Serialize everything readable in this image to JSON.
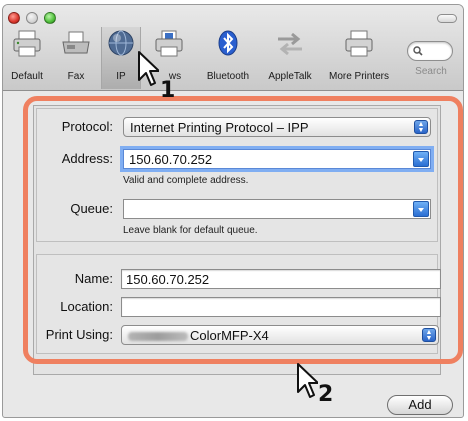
{
  "toolbar": {
    "items": [
      {
        "label": "Default",
        "icon": "default-printer-icon"
      },
      {
        "label": "Fax",
        "icon": "fax-icon"
      },
      {
        "label": "IP",
        "icon": "ip-globe-icon",
        "selected": true
      },
      {
        "label": "ws",
        "icon": "windows-printer-icon"
      },
      {
        "label": "Bluetooth",
        "icon": "bluetooth-icon"
      },
      {
        "label": "AppleTalk",
        "icon": "appletalk-icon"
      },
      {
        "label": "More Printers",
        "icon": "more-printers-icon"
      }
    ],
    "search_label": "Search"
  },
  "form": {
    "protocol": {
      "label": "Protocol:",
      "value": "Internet Printing Protocol – IPP"
    },
    "address": {
      "label": "Address:",
      "value": "150.60.70.252",
      "hint": "Valid and complete address."
    },
    "queue": {
      "label": "Queue:",
      "value": "",
      "hint": "Leave blank for default queue."
    },
    "name": {
      "label": "Name:",
      "value": "150.60.70.252"
    },
    "location": {
      "label": "Location:",
      "value": ""
    },
    "print_using": {
      "label": "Print Using:",
      "value": "ColorMFP-X4"
    }
  },
  "add_label": "Add",
  "callouts": {
    "first": "1",
    "second": "2"
  },
  "colors": {
    "highlight": "#ef8060",
    "focus_ring": "#80aef2",
    "accent_blue": "#2b6fd3"
  }
}
